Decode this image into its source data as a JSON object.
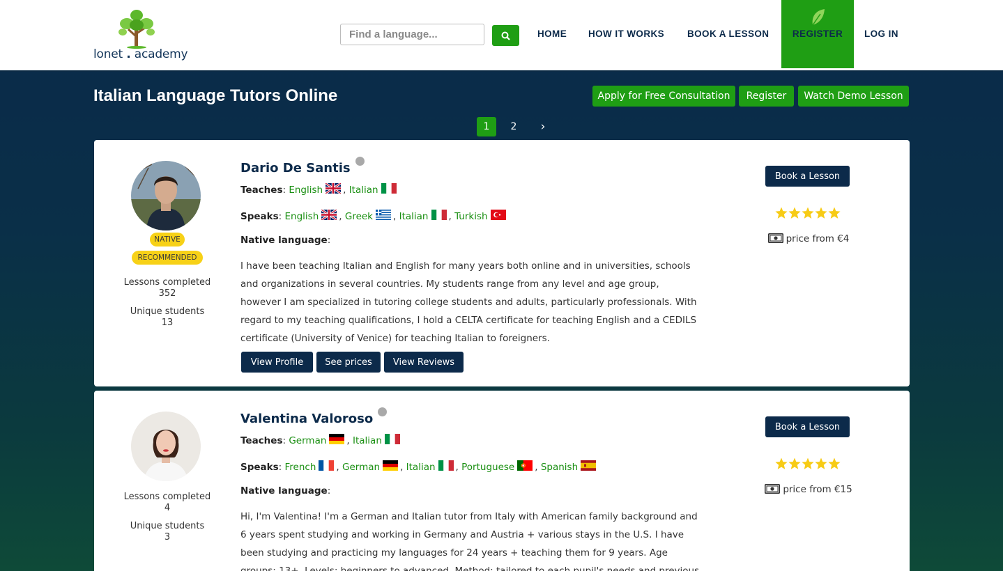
{
  "header": {
    "logo_text_left": "lonet",
    "logo_text_dot": ".",
    "logo_text_right": "academy",
    "search_placeholder": "Find a language...",
    "nav": {
      "home": "HOME",
      "how_it_works": "HOW IT WORKS",
      "book_a_lesson": "BOOK A LESSON",
      "register": "REGISTER",
      "log_in": "LOG IN"
    },
    "accent_color": "#1f9e14",
    "navy_color": "#0c2a4a"
  },
  "page": {
    "title": "Italian Language Tutors Online",
    "actions": {
      "consultation": "Apply for Free Consultation",
      "register": "Register",
      "demo": "Watch Demo Lesson"
    },
    "pagination": {
      "page1": "1",
      "page2": "2",
      "next": "›",
      "current": 1
    }
  },
  "labels": {
    "teaches": "Teaches",
    "speaks": "Speaks",
    "native_language": "Native language",
    "lessons_completed": "Lessons completed",
    "unique_students": "Unique students",
    "book_lesson": "Book a Lesson",
    "view_profile": "View Profile",
    "see_prices": "See prices",
    "view_reviews": "View Reviews"
  },
  "tutors": [
    {
      "name": "Dario De Santis",
      "badges": [
        "NATIVE",
        "RECOMMENDED"
      ],
      "lessons_completed": "352",
      "unique_students": "13",
      "teaches": [
        {
          "lang": "English",
          "flag": "uk-flag"
        },
        {
          "lang": "Italian",
          "flag": "italy-flag"
        }
      ],
      "speaks": [
        {
          "lang": "English",
          "flag": "uk-flag"
        },
        {
          "lang": "Greek",
          "flag": "greece-flag"
        },
        {
          "lang": "Italian",
          "flag": "italy-flag"
        },
        {
          "lang": "Turkish",
          "flag": "turkey-flag"
        }
      ],
      "bio": "I have been teaching Italian and English for many years both online and in universities, schools and organizations in several countries. My students range from any level and age group, however I am specialized in tutoring college students and adults, particularly professionals. With regard to my teaching qualifications, I hold a CELTA certificate for teaching English and a CEDILS certificate (University of Venice) for teaching Italian to foreigners.",
      "rating": 5,
      "price": "price from €4"
    },
    {
      "name": "Valentina Valoroso",
      "badges": [],
      "lessons_completed": "4",
      "unique_students": "3",
      "teaches": [
        {
          "lang": "German",
          "flag": "germany-flag"
        },
        {
          "lang": "Italian",
          "flag": "italy-flag"
        }
      ],
      "speaks": [
        {
          "lang": "French",
          "flag": "france-flag"
        },
        {
          "lang": "German",
          "flag": "germany-flag"
        },
        {
          "lang": "Italian",
          "flag": "italy-flag"
        },
        {
          "lang": "Portuguese",
          "flag": "portugal-flag"
        },
        {
          "lang": "Spanish",
          "flag": "spain-flag"
        }
      ],
      "bio": "Hi, I'm Valentina! I'm a German and Italian tutor from Italy with American family background and 6 years spent studying and working in Germany and Austria + various stays in the U.S. I have been studying and practicing my languages for 24 years + teaching them for 9 years. Age groups: 13+. Levels: beginners to advanced. Method: tailored to each pupil's needs and previous knowledge.",
      "rating": 5,
      "price": "price from €15"
    }
  ]
}
